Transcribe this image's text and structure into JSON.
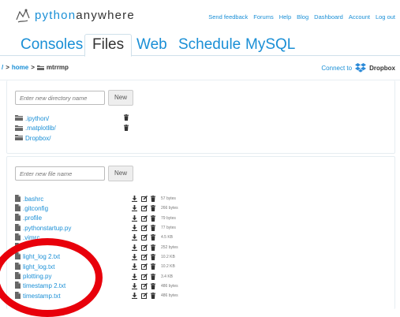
{
  "header": {
    "logo_python": "python",
    "logo_anywhere": "anywhere",
    "nav": [
      "Send feedback",
      "Forums",
      "Help",
      "Blog",
      "Dashboard",
      "Account",
      "Log out"
    ]
  },
  "tabs": [
    "Consoles",
    "Files",
    "Web",
    "Schedule",
    "MySQL"
  ],
  "active_tab": "Files",
  "breadcrumb": {
    "root": "/",
    "home": "home",
    "current": "mtrrmp"
  },
  "dropbox": {
    "label": "Connect to",
    "brand": "Dropbox"
  },
  "directories": {
    "new_placeholder": "Enter new directory name",
    "new_button": "New",
    "items": [
      ".ipython/",
      ".matplotlib/",
      "Dropbox/"
    ]
  },
  "files": {
    "new_placeholder": "Enter new file name",
    "new_button": "New",
    "items": [
      {
        "name": ".bashrc",
        "size": "57 bytes"
      },
      {
        "name": ".gitconfig",
        "size": "266 bytes"
      },
      {
        "name": ".profile",
        "size": "79 bytes"
      },
      {
        "name": ".pythonstartup.py",
        "size": "77 bytes"
      },
      {
        "name": ".vimrc",
        "size": "4.5 KB"
      },
      {
        "name": "",
        "size": "252 bytes"
      },
      {
        "name": "light_log 2.txt",
        "size": "10.2 KB"
      },
      {
        "name": "light_log.txt",
        "size": "10.2 KB"
      },
      {
        "name": "plotting.py",
        "size": "3.4 KB"
      },
      {
        "name": "timestamp 2.txt",
        "size": "486 bytes"
      },
      {
        "name": "timestamp.txt",
        "size": "486 bytes"
      }
    ]
  },
  "colors": {
    "link": "#1a8fd6",
    "annotation_circle": "#e8000b"
  }
}
